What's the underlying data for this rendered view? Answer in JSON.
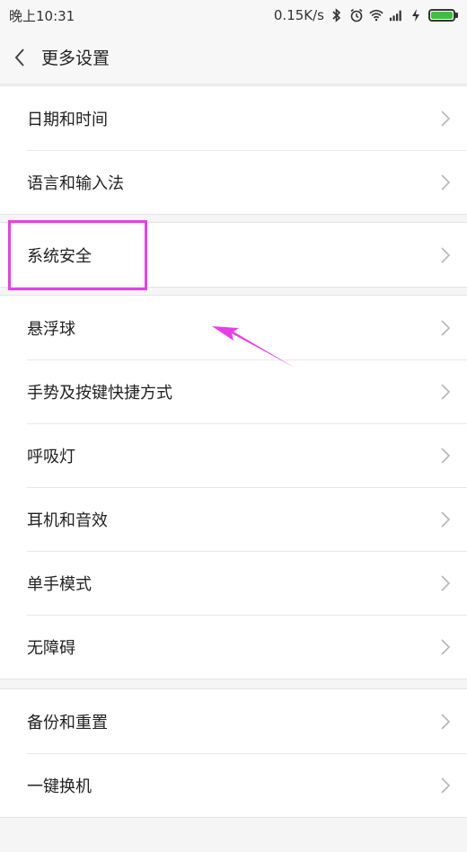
{
  "status_bar": {
    "time": "晚上10:31",
    "speed": "0.15K/s",
    "icons": [
      "bluetooth-icon",
      "alarm-icon",
      "wifi-icon",
      "signal-icon",
      "charging-icon",
      "battery-icon"
    ]
  },
  "header": {
    "title": "更多设置"
  },
  "groups": [
    {
      "items": [
        "日期和时间",
        "语言和输入法"
      ]
    },
    {
      "items": [
        "系统安全"
      ]
    },
    {
      "items": [
        "悬浮球",
        "手势及按键快捷方式",
        "呼吸灯",
        "耳机和音效",
        "单手模式",
        "无障碍"
      ]
    },
    {
      "items": [
        "备份和重置",
        "一键换机"
      ]
    }
  ],
  "colors": {
    "annotation": "#e83ee8",
    "battery": "#3fbf3f"
  }
}
